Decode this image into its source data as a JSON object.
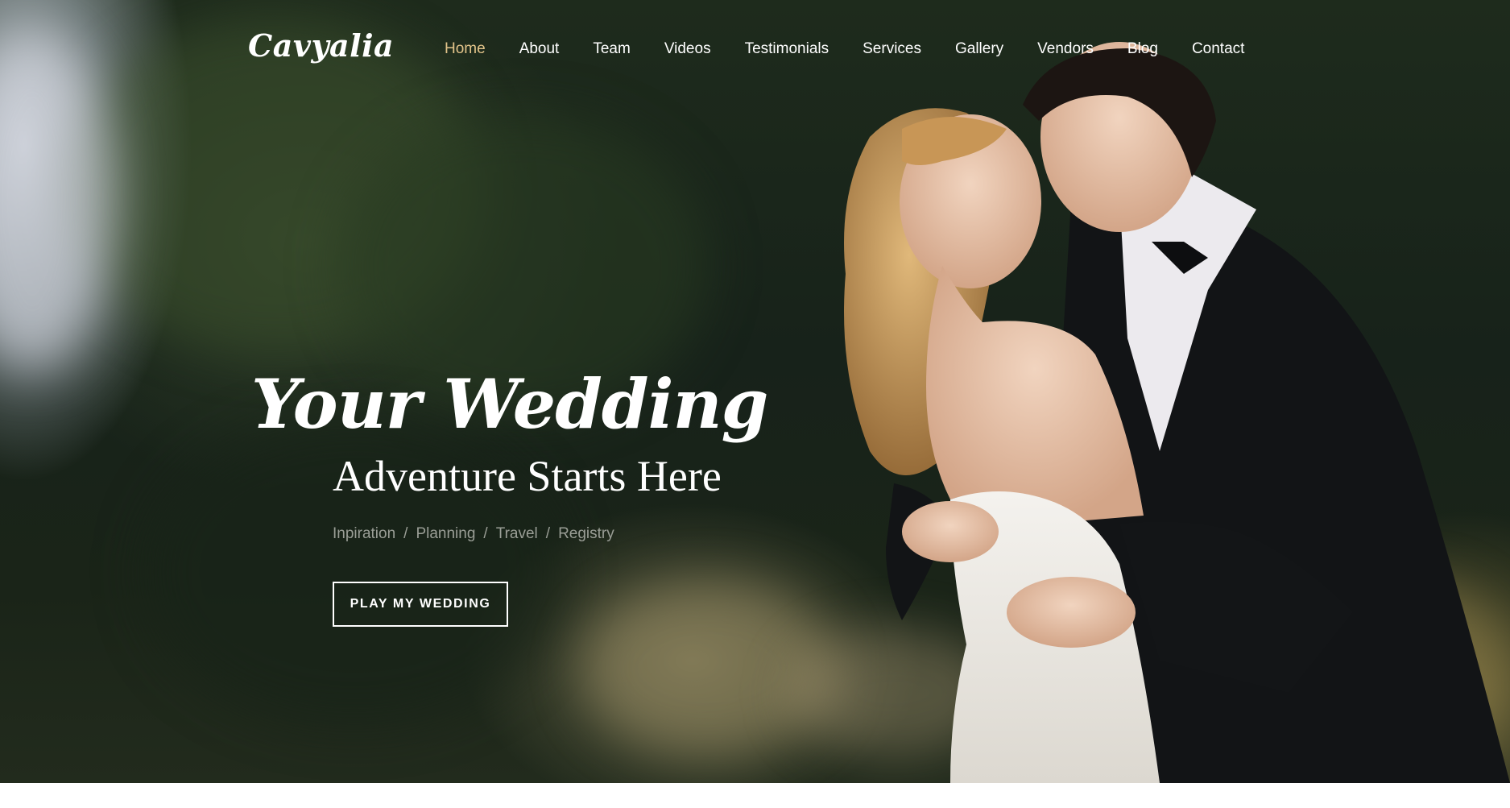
{
  "brand": {
    "logo_text": "Cavyalia"
  },
  "nav": {
    "items": [
      {
        "label": "Home",
        "active": true
      },
      {
        "label": "About",
        "active": false
      },
      {
        "label": "Team",
        "active": false
      },
      {
        "label": "Videos",
        "active": false
      },
      {
        "label": "Testimonials",
        "active": false
      },
      {
        "label": "Services",
        "active": false
      },
      {
        "label": "Gallery",
        "active": false
      },
      {
        "label": "Vendors",
        "active": false
      },
      {
        "label": "Blog",
        "active": false
      },
      {
        "label": "Contact",
        "active": false
      }
    ]
  },
  "hero": {
    "headline": "Your Wedding",
    "subheadline": "Adventure Starts Here",
    "tagline": [
      "Inpiration",
      "Planning",
      "Travel",
      "Registry"
    ],
    "tagline_separator": "/",
    "cta_label": "PLAY MY WEDDING",
    "image": "wedding-couple-kissing-photo"
  },
  "colors": {
    "accent": "#e2c48a",
    "text": "#ffffff",
    "muted": "#9a9e96"
  }
}
